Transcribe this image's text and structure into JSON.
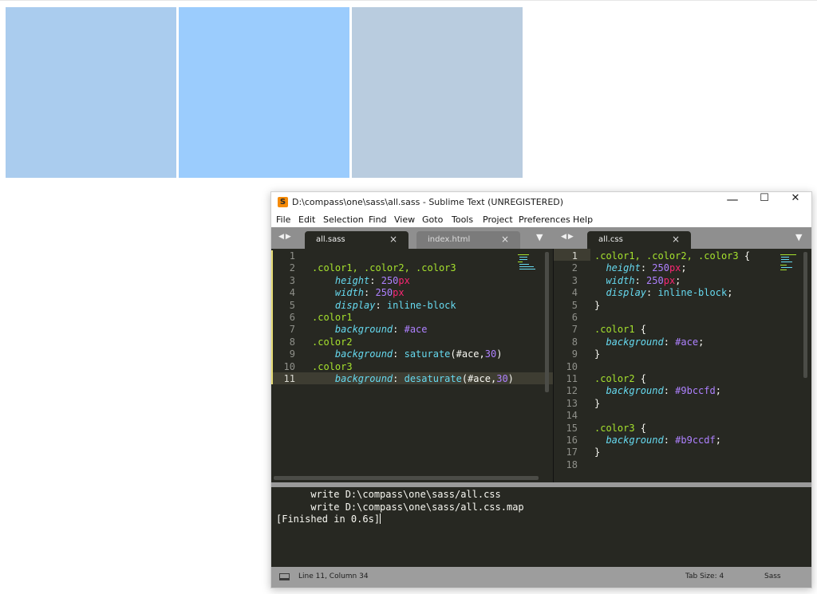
{
  "swatches": [
    {
      "name": "color1",
      "color": "#aaccee"
    },
    {
      "name": "color2",
      "color": "#9bccfd"
    },
    {
      "name": "color3",
      "color": "#b9ccdf"
    }
  ],
  "window": {
    "title": "D:\\compass\\one\\sass\\all.sass - Sublime Text (UNREGISTERED)",
    "controls": {
      "minimize": "—",
      "maximize": "☐",
      "close": "✕"
    }
  },
  "menu": [
    "File",
    "Edit",
    "Selection",
    "Find",
    "View",
    "Goto",
    "Tools",
    "Project",
    "Preferences",
    "Help"
  ],
  "tab_nav_arrows": "◀▶",
  "left_tabs": [
    {
      "label": "all.sass",
      "close": "×"
    },
    {
      "label": "index.html",
      "close": "×"
    }
  ],
  "right_tabs": [
    {
      "label": "all.css",
      "close": "×"
    }
  ],
  "tab_dropdown": "▼",
  "editor_left": {
    "line_numbers": [
      "1",
      "2",
      "3",
      "4",
      "5",
      "6",
      "7",
      "8",
      "9",
      "10",
      "11"
    ],
    "lines": [
      [],
      [
        {
          "t": ".color1, .color2, .color3",
          "c": "sel"
        }
      ],
      [
        {
          "t": "    ",
          "c": "plain"
        },
        {
          "t": "height",
          "c": "prop"
        },
        {
          "t": ": ",
          "c": "plain"
        },
        {
          "t": "250",
          "c": "num"
        },
        {
          "t": "px",
          "c": "unit"
        }
      ],
      [
        {
          "t": "    ",
          "c": "plain"
        },
        {
          "t": "width",
          "c": "prop"
        },
        {
          "t": ": ",
          "c": "plain"
        },
        {
          "t": "250",
          "c": "num"
        },
        {
          "t": "px",
          "c": "unit"
        }
      ],
      [
        {
          "t": "    ",
          "c": "plain"
        },
        {
          "t": "display",
          "c": "prop"
        },
        {
          "t": ": ",
          "c": "plain"
        },
        {
          "t": "inline-block",
          "c": "val"
        }
      ],
      [
        {
          "t": ".color1",
          "c": "sel"
        }
      ],
      [
        {
          "t": "    ",
          "c": "plain"
        },
        {
          "t": "background",
          "c": "prop"
        },
        {
          "t": ": ",
          "c": "plain"
        },
        {
          "t": "#ace",
          "c": "num"
        }
      ],
      [
        {
          "t": ".color2",
          "c": "sel"
        }
      ],
      [
        {
          "t": "    ",
          "c": "plain"
        },
        {
          "t": "background",
          "c": "prop"
        },
        {
          "t": ": ",
          "c": "plain"
        },
        {
          "t": "saturate",
          "c": "val"
        },
        {
          "t": "(#ace,",
          "c": "plain"
        },
        {
          "t": "30",
          "c": "num"
        },
        {
          "t": ")",
          "c": "plain"
        }
      ],
      [
        {
          "t": ".color3",
          "c": "sel"
        }
      ],
      [
        {
          "t": "    ",
          "c": "plain"
        },
        {
          "t": "background",
          "c": "prop"
        },
        {
          "t": ": ",
          "c": "plain"
        },
        {
          "t": "desaturate",
          "c": "val"
        },
        {
          "t": "(#ace,",
          "c": "plain"
        },
        {
          "t": "30",
          "c": "num"
        },
        {
          "t": ")",
          "c": "plain"
        }
      ]
    ]
  },
  "editor_right": {
    "line_numbers": [
      "1",
      "2",
      "3",
      "4",
      "5",
      "6",
      "7",
      "8",
      "9",
      "10",
      "11",
      "12",
      "13",
      "14",
      "15",
      "16",
      "17",
      "18"
    ],
    "lines": [
      [
        {
          "t": ".color1, .color2, .color3 ",
          "c": "sel"
        },
        {
          "t": "{",
          "c": "plain"
        }
      ],
      [
        {
          "t": "  ",
          "c": "plain"
        },
        {
          "t": "height",
          "c": "prop"
        },
        {
          "t": ": ",
          "c": "plain"
        },
        {
          "t": "250",
          "c": "num"
        },
        {
          "t": "px",
          "c": "unit"
        },
        {
          "t": ";",
          "c": "plain"
        }
      ],
      [
        {
          "t": "  ",
          "c": "plain"
        },
        {
          "t": "width",
          "c": "prop"
        },
        {
          "t": ": ",
          "c": "plain"
        },
        {
          "t": "250",
          "c": "num"
        },
        {
          "t": "px",
          "c": "unit"
        },
        {
          "t": ";",
          "c": "plain"
        }
      ],
      [
        {
          "t": "  ",
          "c": "plain"
        },
        {
          "t": "display",
          "c": "prop"
        },
        {
          "t": ": ",
          "c": "plain"
        },
        {
          "t": "inline-block",
          "c": "val"
        },
        {
          "t": ";",
          "c": "plain"
        }
      ],
      [
        {
          "t": "}",
          "c": "plain"
        }
      ],
      [],
      [
        {
          "t": ".color1 ",
          "c": "sel"
        },
        {
          "t": "{",
          "c": "plain"
        }
      ],
      [
        {
          "t": "  ",
          "c": "plain"
        },
        {
          "t": "background",
          "c": "prop"
        },
        {
          "t": ": ",
          "c": "plain"
        },
        {
          "t": "#ace",
          "c": "num"
        },
        {
          "t": ";",
          "c": "plain"
        }
      ],
      [
        {
          "t": "}",
          "c": "plain"
        }
      ],
      [],
      [
        {
          "t": ".color2 ",
          "c": "sel"
        },
        {
          "t": "{",
          "c": "plain"
        }
      ],
      [
        {
          "t": "  ",
          "c": "plain"
        },
        {
          "t": "background",
          "c": "prop"
        },
        {
          "t": ": ",
          "c": "plain"
        },
        {
          "t": "#9bccfd",
          "c": "num"
        },
        {
          "t": ";",
          "c": "plain"
        }
      ],
      [
        {
          "t": "}",
          "c": "plain"
        }
      ],
      [],
      [
        {
          "t": ".color3 ",
          "c": "sel"
        },
        {
          "t": "{",
          "c": "plain"
        }
      ],
      [
        {
          "t": "  ",
          "c": "plain"
        },
        {
          "t": "background",
          "c": "prop"
        },
        {
          "t": ": ",
          "c": "plain"
        },
        {
          "t": "#b9ccdf",
          "c": "num"
        },
        {
          "t": ";",
          "c": "plain"
        }
      ],
      [
        {
          "t": "}",
          "c": "plain"
        }
      ],
      []
    ]
  },
  "output": {
    "lines": [
      "      write D:\\compass\\one\\sass/all.css",
      "      write D:\\compass\\one\\sass/all.css.map",
      "[Finished in 0.6s]"
    ]
  },
  "status": {
    "position": "Line 11, Column 34",
    "tab_size": "Tab Size: 4",
    "syntax": "Sass"
  },
  "theme": {
    "editor_bg": "#272822",
    "selector": "#a6e22e",
    "property": "#66d9ef",
    "number": "#ae81ff",
    "unit": "#f92672"
  }
}
